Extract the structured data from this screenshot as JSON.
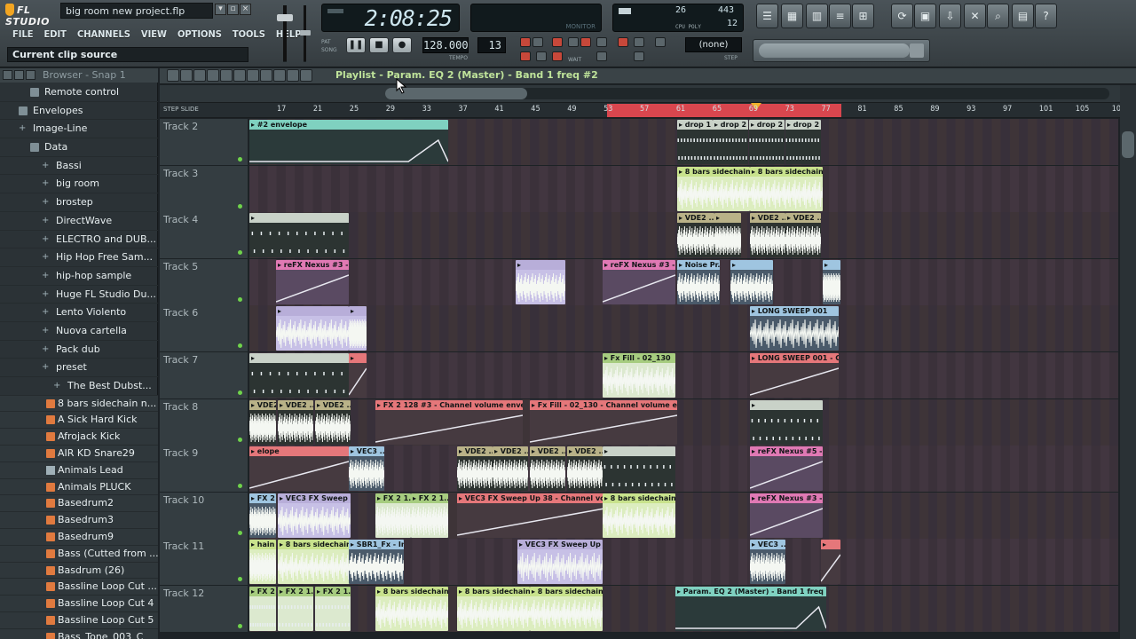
{
  "app": {
    "logo": "FL STUDIO",
    "project": "big room new project.flp",
    "hint": "Current clip source"
  },
  "menu": [
    "FILE",
    "EDIT",
    "CHANNELS",
    "VIEW",
    "OPTIONS",
    "TOOLS",
    "HELP"
  ],
  "transport": {
    "time": "2:08:25",
    "tempo": "128.000",
    "pattern": "13",
    "pat_label": "PAT",
    "song_label": "SONG",
    "tempo_label": "TEMPO",
    "monitor_label": "MONITOR",
    "cpu_a": "26",
    "cpu_b": "443",
    "cpu_c": "12",
    "cpu_label": "CPU POLY",
    "none": "(none)",
    "wait_label": "WAIT",
    "step_label": "STEP"
  },
  "browser": {
    "title": "Browser - Snap 1",
    "items": [
      {
        "label": "Remote control",
        "icon": "folder",
        "indent": 2
      },
      {
        "label": "Envelopes",
        "icon": "folder",
        "indent": 1
      },
      {
        "label": "Image-Line",
        "icon": "plus",
        "indent": 1
      },
      {
        "label": "Data",
        "icon": "folder",
        "indent": 2
      },
      {
        "label": "Bassi",
        "icon": "plus",
        "indent": 3
      },
      {
        "label": "big room",
        "icon": "plus",
        "indent": 3
      },
      {
        "label": "brostep",
        "icon": "plus",
        "indent": 3
      },
      {
        "label": "DirectWave",
        "icon": "plus",
        "indent": 3
      },
      {
        "label": "ELECTRO and DUB...",
        "icon": "plus",
        "indent": 3
      },
      {
        "label": "Hip Hop Free Sam...",
        "icon": "plus",
        "indent": 3
      },
      {
        "label": "hip-hop sample",
        "icon": "plus",
        "indent": 3
      },
      {
        "label": "Huge FL Studio Du...",
        "icon": "plus",
        "indent": 3
      },
      {
        "label": "Lento Violento",
        "icon": "plus",
        "indent": 3
      },
      {
        "label": "Nuova cartella",
        "icon": "plus",
        "indent": 3
      },
      {
        "label": "Pack dub",
        "icon": "plus",
        "indent": 3
      },
      {
        "label": "preset",
        "icon": "plus",
        "indent": 3
      },
      {
        "label": "The Best Dubst...",
        "icon": "plus",
        "indent": 4
      }
    ],
    "files": [
      {
        "label": "8 bars sidechain n...",
        "icon": "wav"
      },
      {
        "label": "A Sick Hard Kick",
        "icon": "wav"
      },
      {
        "label": "Afrojack Kick",
        "icon": "wav"
      },
      {
        "label": "AIR KD Snare29",
        "icon": "wav"
      },
      {
        "label": "Animals Lead",
        "icon": "plug"
      },
      {
        "label": "Animals PLUCK",
        "icon": "wav"
      },
      {
        "label": "Basedrum2",
        "icon": "wav"
      },
      {
        "label": "Basedrum3",
        "icon": "wav"
      },
      {
        "label": "Basedrum9",
        "icon": "wav"
      },
      {
        "label": "Bass (Cutted from ...",
        "icon": "wav"
      },
      {
        "label": "Basdrum (26)",
        "icon": "wav"
      },
      {
        "label": "Bassline Loop Cut ...",
        "icon": "wav"
      },
      {
        "label": "Bassline Loop Cut 4",
        "icon": "wav"
      },
      {
        "label": "Bassline Loop Cut 5",
        "icon": "wav"
      },
      {
        "label": "Bass_Tone_003_C",
        "icon": "wav"
      }
    ]
  },
  "playlist": {
    "title": "Playlist - Param. EQ 2 (Master) - Band 1 freq #2",
    "step_label": "STEP",
    "slide_label": "SLIDE",
    "ruler": [
      "17",
      "21",
      "25",
      "29",
      "33",
      "37",
      "41",
      "45",
      "49",
      "53",
      "57",
      "61",
      "65",
      "69",
      "73",
      "77",
      "81",
      "85",
      "89",
      "93",
      "97",
      "101",
      "105",
      "10"
    ],
    "tracks": [
      {
        "name": "Track 2",
        "clips": [
          {
            "label": "#2 envelope",
            "style": "teal",
            "kind": "env"
          },
          {
            "label": "drop 1",
            "style": "grey",
            "kind": "notes"
          },
          {
            "label": "drop 2",
            "style": "grey",
            "kind": "notes"
          },
          {
            "label": "drop 2",
            "style": "grey",
            "kind": "notes"
          },
          {
            "label": "drop 2",
            "style": "grey",
            "kind": "notes"
          }
        ]
      },
      {
        "name": "Track 3",
        "clips": [
          {
            "label": "8 bars sidechain n...",
            "style": "lime",
            "kind": "wave"
          },
          {
            "label": "8 bars sidechain n...",
            "style": "lime",
            "kind": "wave"
          }
        ]
      },
      {
        "name": "Track 4",
        "clips": [
          {
            "label": "",
            "style": "grey",
            "kind": "notes"
          },
          {
            "label": "VDE2 ...",
            "style": "olive",
            "kind": "wave"
          },
          {
            "label": "",
            "style": "olive",
            "kind": "wave"
          },
          {
            "label": "VDE2 ...",
            "style": "olive",
            "kind": "wave"
          },
          {
            "label": "VDE2 ...",
            "style": "olive",
            "kind": "wave"
          }
        ]
      },
      {
        "name": "Track 5",
        "clips": [
          {
            "label": "reFX Nexus #3 - C...",
            "style": "pink",
            "kind": "ramp"
          },
          {
            "label": "reFX Nexus #3 - C...",
            "style": "pink",
            "kind": "ramp"
          },
          {
            "label": "Noise Pr...",
            "style": "sky",
            "kind": "wave"
          },
          {
            "label": "",
            "style": "sky",
            "kind": "wave"
          },
          {
            "label": "",
            "style": "sky",
            "kind": "wave"
          },
          {
            "label": "",
            "style": "lav",
            "kind": "wave"
          }
        ]
      },
      {
        "name": "Track 6",
        "clips": [
          {
            "label": "",
            "style": "lav",
            "kind": "wave"
          },
          {
            "label": "",
            "style": "lav",
            "kind": "wave"
          },
          {
            "label": "LONG SWEEP 001",
            "style": "sky",
            "kind": "wave"
          }
        ]
      },
      {
        "name": "Track 7",
        "clips": [
          {
            "label": "",
            "style": "grey",
            "kind": "notes"
          },
          {
            "label": "",
            "style": "red",
            "kind": "ramp"
          },
          {
            "label": "Fx Fill - 02_130",
            "style": "green",
            "kind": "wave"
          },
          {
            "label": "LONG SWEEP 001 - Cha...",
            "style": "red",
            "kind": "ramp"
          }
        ]
      },
      {
        "name": "Track 8",
        "clips": [
          {
            "label": "VDE2 ...",
            "style": "olive",
            "kind": "wave"
          },
          {
            "label": "VDE2 ...",
            "style": "olive",
            "kind": "wave"
          },
          {
            "label": "VDE2 ...",
            "style": "olive",
            "kind": "wave"
          },
          {
            "label": "FX 2 128 #3 - Channel volume envelope",
            "style": "red",
            "kind": "ramp"
          },
          {
            "label": "Fx Fill - 02_130 - Channel volume envelope",
            "style": "red",
            "kind": "ramp"
          },
          {
            "label": "",
            "style": "grey",
            "kind": "notes"
          }
        ]
      },
      {
        "name": "Track 9",
        "clips": [
          {
            "label": "elope",
            "style": "red",
            "kind": "ramp"
          },
          {
            "label": "VEC3 ...",
            "style": "sky",
            "kind": "wave"
          },
          {
            "label": "VDE2 ...",
            "style": "olive",
            "kind": "wave"
          },
          {
            "label": "VDE2 ...",
            "style": "olive",
            "kind": "wave"
          },
          {
            "label": "VDE2 ...",
            "style": "olive",
            "kind": "wave"
          },
          {
            "label": "VDE2 ...",
            "style": "olive",
            "kind": "wave"
          },
          {
            "label": "",
            "style": "grey",
            "kind": "notes"
          },
          {
            "label": "reFX Nexus #5 - Ch...",
            "style": "pink",
            "kind": "ramp"
          }
        ]
      },
      {
        "name": "Track 10",
        "clips": [
          {
            "label": "FX 2",
            "style": "sky",
            "kind": "wave"
          },
          {
            "label": "VEC3 FX Sweep Up 38",
            "style": "lav",
            "kind": "wave"
          },
          {
            "label": "FX 2 1...",
            "style": "green",
            "kind": "wave"
          },
          {
            "label": "FX 2 1...",
            "style": "green",
            "kind": "wave"
          },
          {
            "label": "VEC3 FX Sweep Up 38 - Channel volume e...",
            "style": "red",
            "kind": "ramp"
          },
          {
            "label": "8 bars sidechain n...",
            "style": "lime",
            "kind": "wave"
          },
          {
            "label": "reFX Nexus #3 - Ch...",
            "style": "pink",
            "kind": "ramp"
          }
        ]
      },
      {
        "name": "Track 11",
        "clips": [
          {
            "label": "hain n...",
            "style": "lime",
            "kind": "wave"
          },
          {
            "label": "8 bars sidechain n...",
            "style": "lime",
            "kind": "wave"
          },
          {
            "label": "SBR1_Fx - Im...",
            "style": "sky",
            "kind": "wave"
          },
          {
            "label": "VEC3 FX Sweep Up 38",
            "style": "lav",
            "kind": "wave"
          },
          {
            "label": "VEC3 ...",
            "style": "sky",
            "kind": "wave"
          },
          {
            "label": "",
            "style": "red",
            "kind": "ramp"
          }
        ]
      },
      {
        "name": "Track 12",
        "clips": [
          {
            "label": "FX 2 1...",
            "style": "green",
            "kind": "notes"
          },
          {
            "label": "FX 2 1...",
            "style": "green",
            "kind": "notes"
          },
          {
            "label": "FX 2 1...",
            "style": "green",
            "kind": "notes"
          },
          {
            "label": "8 bars sidechain n...",
            "style": "lime",
            "kind": "wave"
          },
          {
            "label": "8 bars sidechain n...",
            "style": "lime",
            "kind": "wave"
          },
          {
            "label": "8 bars sidechain n...",
            "style": "lime",
            "kind": "wave"
          },
          {
            "label": "Param. EQ 2 (Master) - Band 1 freq envelope",
            "style": "teal",
            "kind": "env"
          }
        ]
      }
    ]
  },
  "colors": {
    "accent": "#f2a522",
    "loop": "#d9464e",
    "marker": "#f1b22a",
    "title_text": "#bfe39a"
  }
}
